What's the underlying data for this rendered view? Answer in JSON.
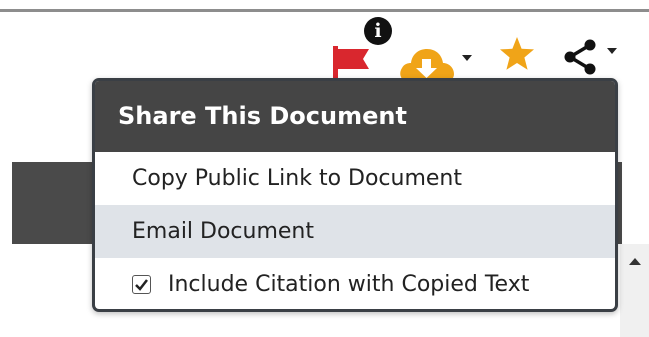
{
  "toolbar": {
    "info_icon_glyph": "i",
    "icons": [
      "info-icon",
      "flag-icon",
      "download-icon",
      "star-icon",
      "share-icon"
    ],
    "colors": {
      "flag": "#d9272e",
      "download": "#f0a418",
      "star": "#f0a418",
      "share": "#111111"
    }
  },
  "share_menu": {
    "title": "Share This Document",
    "items": [
      {
        "label": "Copy Public Link to Document"
      },
      {
        "label": "Email Document"
      }
    ],
    "checkbox": {
      "label": "Include Citation with Copied Text",
      "checked": true
    }
  }
}
